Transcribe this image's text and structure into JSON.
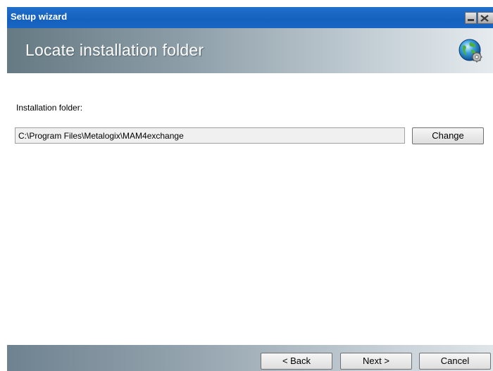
{
  "window": {
    "title": "Setup wizard",
    "controls": [
      "minimize-icon",
      "close-icon"
    ]
  },
  "header": {
    "title": "Locate installation folder",
    "icon": "globe-gear-icon"
  },
  "main": {
    "folder_label": "Installation folder:",
    "folder_path": "C:\\Program Files\\Metalogix\\MAM4exchange",
    "change_label": "Change"
  },
  "footer": {
    "back_label": "< Back",
    "next_label": "Next >",
    "cancel_label": "Cancel"
  },
  "colors": {
    "titlebar": "#1560bd",
    "header_dark": "#667a84",
    "header_light": "#e6ebee",
    "input_bg": "#f0f0f0"
  }
}
